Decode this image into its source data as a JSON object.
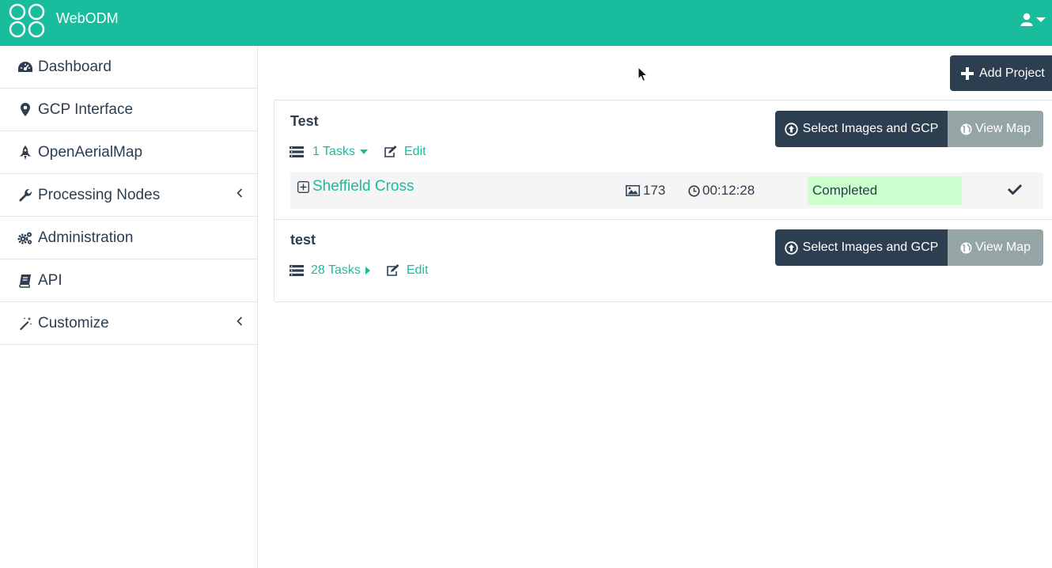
{
  "app": {
    "brand": "WebODM"
  },
  "sidebar": {
    "items": [
      {
        "label": "Dashboard",
        "icon": "dashboard-icon"
      },
      {
        "label": "GCP Interface",
        "icon": "map-marker-icon"
      },
      {
        "label": "OpenAerialMap",
        "icon": "rocket-icon"
      },
      {
        "label": "Processing Nodes",
        "icon": "wrench-icon",
        "expandable": true
      },
      {
        "label": "Administration",
        "icon": "gears-icon"
      },
      {
        "label": "API",
        "icon": "book-icon"
      },
      {
        "label": "Customize",
        "icon": "magic-wand-icon",
        "expandable": true
      }
    ]
  },
  "toolbar": {
    "add_project_label": "Add Project"
  },
  "projects": [
    {
      "name": "Test",
      "tasks_label": "1 Tasks",
      "tasks_expanded": true,
      "edit_label": "Edit",
      "select_label": "Select Images and GCP",
      "view_map_label": "View Map",
      "tasks": [
        {
          "name": "Sheffield Cross",
          "images": "173",
          "duration": "00:12:28",
          "status": "Completed"
        }
      ]
    },
    {
      "name": "test",
      "tasks_label": "28 Tasks",
      "tasks_expanded": false,
      "edit_label": "Edit",
      "select_label": "Select Images and GCP",
      "view_map_label": "View Map",
      "tasks": []
    }
  ],
  "colors": {
    "brand": "#19bc9c",
    "dark": "#2c3e50",
    "secondary": "#95a5a6",
    "completed_bg": "#cbffcd"
  }
}
